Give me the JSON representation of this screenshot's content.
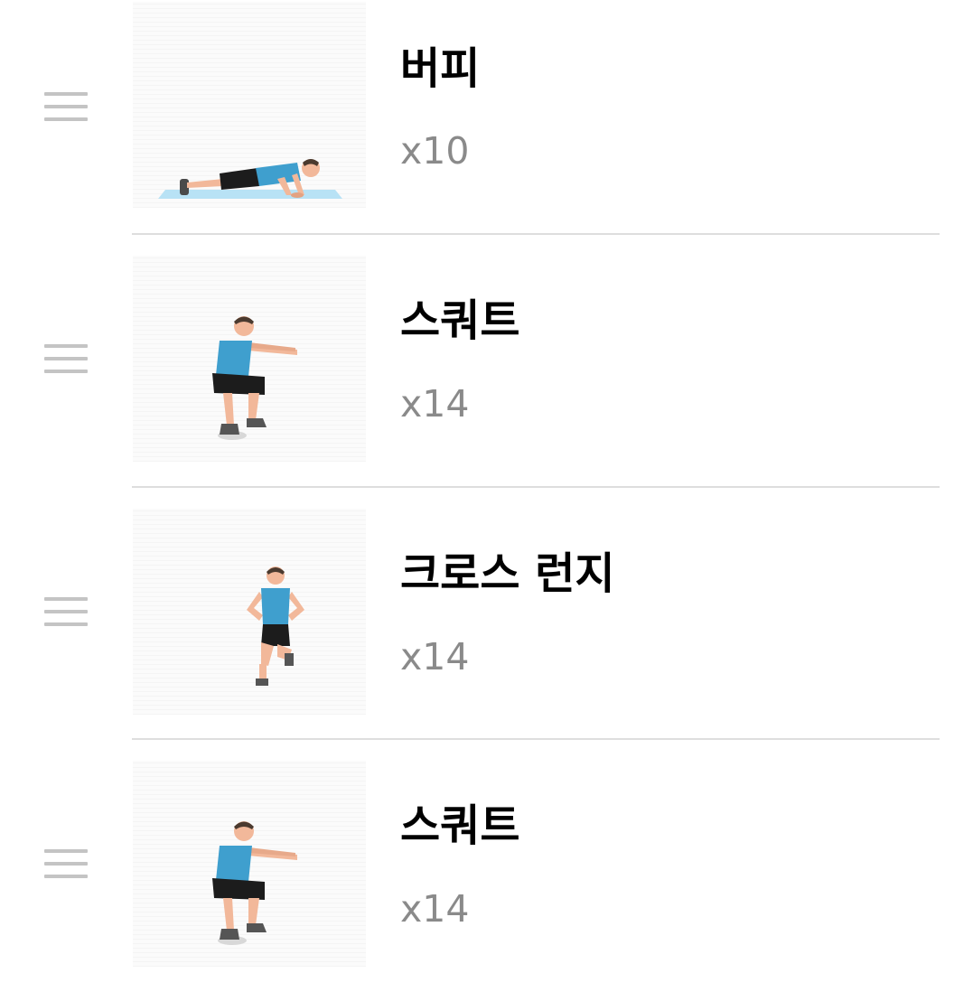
{
  "colors": {
    "title": "#000000",
    "reps": "#8a8a8a",
    "divider": "#dedede",
    "drag_handle": "#c4c4c4",
    "tank_top": "#3f9fce",
    "skin": "#f2b89a",
    "shorts": "#1c1c1c",
    "mat": "#b8e2f5"
  },
  "exercises": [
    {
      "name": "버피",
      "reps": "x10",
      "illustration": "push-up-position-figure"
    },
    {
      "name": "스쿼트",
      "reps": "x14",
      "illustration": "squat-figure"
    },
    {
      "name": "크로스 런지",
      "reps": "x14",
      "illustration": "cross-lunge-figure"
    },
    {
      "name": "스쿼트",
      "reps": "x14",
      "illustration": "squat-figure"
    }
  ],
  "icons": {
    "drag_handle": "drag-handle-icon"
  }
}
